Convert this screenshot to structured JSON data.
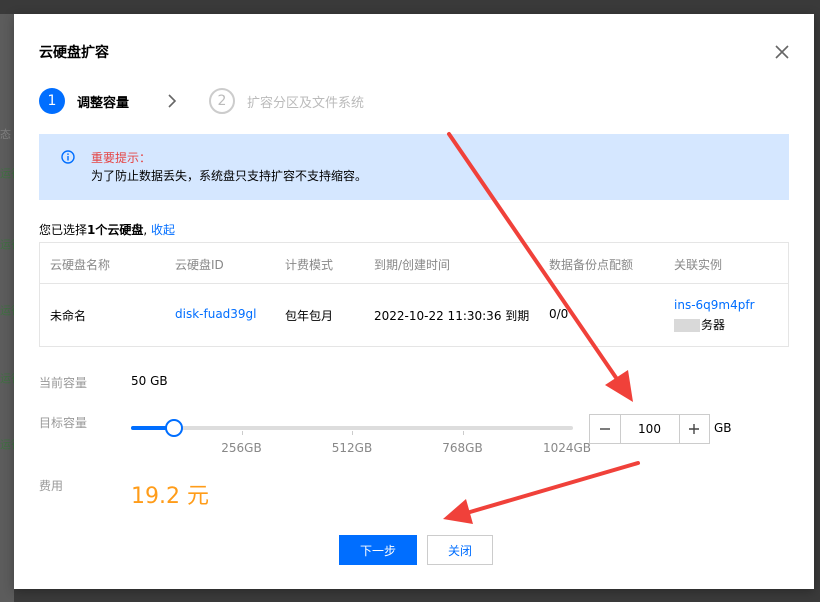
{
  "dialog": {
    "title": "云硬盘扩容"
  },
  "steps": [
    {
      "number": "1",
      "label": "调整容量",
      "active": true
    },
    {
      "number": "2",
      "label": "扩容分区及文件系统",
      "active": false
    }
  ],
  "notice": {
    "title": "重要提示：",
    "text": "为了防止数据丢失，系统盘只支持扩容不支持缩容。"
  },
  "selection": {
    "prefix": "您已选择",
    "count": "1个云硬盘",
    "collapse_link": "收起"
  },
  "table": {
    "columns": [
      "云硬盘名称",
      "云硬盘ID",
      "计费模式",
      "到期/创建时间",
      "数据备份点配额",
      "关联实例"
    ],
    "rows": [
      {
        "name": "未命名",
        "id": "disk-fuad39gl",
        "billing": "包年包月",
        "expiry": "2022-10-22 11:30:36 到期",
        "backup_quota": "0/0",
        "instance_id": "ins-6q9m4pfr",
        "instance_name_suffix": "务器"
      }
    ]
  },
  "capacity": {
    "current_label": "当前容量",
    "current_value": "50 GB",
    "target_label": "目标容量",
    "slider_value": 100,
    "slider_min": 0,
    "slider_max": 1024,
    "ticks": [
      "256GB",
      "512GB",
      "768GB",
      "1024GB"
    ],
    "tick_values": [
      256,
      512,
      768,
      1024
    ],
    "input_value": "100",
    "unit": "GB"
  },
  "fee": {
    "label": "费用",
    "value": "19.2 元"
  },
  "buttons": {
    "next": "下一步",
    "close": "关闭"
  },
  "colors": {
    "primary": "#006eff",
    "notice_bg": "#d5e7ff",
    "warning_text": "#e54545",
    "price": "#ff9c19",
    "annotation_arrow": "#f0413a"
  },
  "icons": {
    "close": "close-icon",
    "info": "info-icon",
    "chevron": "chevron-right-icon",
    "minus": "minus-icon",
    "plus": "plus-icon"
  },
  "background_fragments": [
    "态",
    "运行中",
    "运行中",
    "运行中",
    "运行中",
    "运行中"
  ]
}
